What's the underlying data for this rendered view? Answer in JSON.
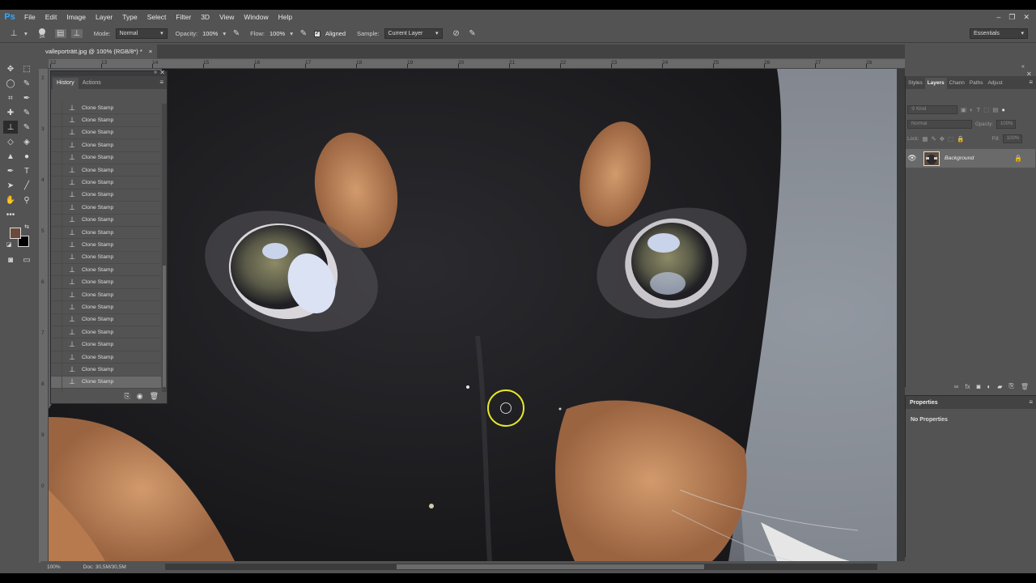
{
  "app": {
    "logo": "Ps"
  },
  "menu": [
    "File",
    "Edit",
    "Image",
    "Layer",
    "Type",
    "Select",
    "Filter",
    "3D",
    "View",
    "Window",
    "Help"
  ],
  "window_controls": {
    "minimize": "–",
    "restore": "❐",
    "close": "✕"
  },
  "options": {
    "brush_size": "34",
    "mode_label": "Mode:",
    "mode_value": "Normal",
    "opacity_label": "Opacity:",
    "opacity_value": "100%",
    "flow_label": "Flow:",
    "flow_value": "100%",
    "aligned_label": "Aligned",
    "sample_label": "Sample:",
    "sample_value": "Current Layer",
    "workspace": "Essentials"
  },
  "document": {
    "tab_title": "valleporträtt.jpg @ 100% (RGB/8*) *",
    "close": "×",
    "zoom": "100%",
    "doc_info": "Doc: 30,5M/30,5M"
  },
  "ruler": {
    "top": [
      "12",
      "13",
      "14",
      "15",
      "16",
      "17",
      "18",
      "19",
      "20",
      "21",
      "22",
      "23",
      "24",
      "25",
      "26",
      "27",
      "28",
      "29"
    ],
    "left": [
      "2",
      "3",
      "4",
      "5",
      "6",
      "7",
      "8",
      "9",
      "0"
    ]
  },
  "history": {
    "tabs": [
      "History",
      "Actions"
    ],
    "items": [
      "Clone Stamp",
      "Clone Stamp",
      "Clone Stamp",
      "Clone Stamp",
      "Clone Stamp",
      "Clone Stamp",
      "Clone Stamp",
      "Clone Stamp",
      "Clone Stamp",
      "Clone Stamp",
      "Clone Stamp",
      "Clone Stamp",
      "Clone Stamp",
      "Clone Stamp",
      "Clone Stamp",
      "Clone Stamp",
      "Clone Stamp",
      "Clone Stamp",
      "Clone Stamp",
      "Clone Stamp",
      "Clone Stamp",
      "Clone Stamp",
      "Clone Stamp"
    ],
    "current_item": "Clone Stamp",
    "undone_item": "Clone Stamp"
  },
  "layers": {
    "tabs": [
      "Styles",
      "Layers",
      "Chann",
      "Paths",
      "Adjust"
    ],
    "kind_placeholder": "Kind",
    "blend_mode": "Normal",
    "opacity_label": "Opacity:",
    "opacity_value": "100%",
    "lock_label": "Lock:",
    "fill_label": "Fill:",
    "fill_value": "100%",
    "layer_name": "Background"
  },
  "properties": {
    "title": "Properties",
    "empty_text": "No Properties"
  },
  "colors": {
    "foreground": "#6b4a3c",
    "background": "#000000",
    "brush_ring": "#e8e82a",
    "ui": "#535353"
  }
}
